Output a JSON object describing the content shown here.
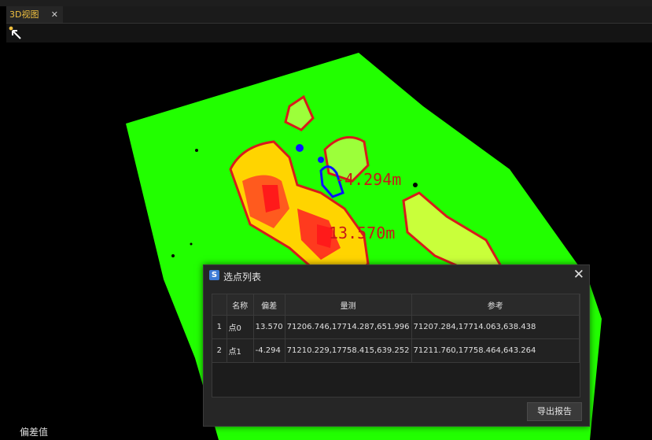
{
  "tab": {
    "label": "3D视图",
    "close_glyph": "✕"
  },
  "toolbar": {
    "select_tool_icon": "cursor-arrow-icon"
  },
  "viewport": {
    "labels": [
      "-4.294m",
      "13.570m"
    ],
    "bottom_label": "偏差值"
  },
  "dialog": {
    "title": "选点列表",
    "icon_glyph": "S",
    "close_glyph": "✕",
    "columns": [
      "",
      "名称",
      "偏差",
      "量测",
      "参考"
    ],
    "rows": [
      [
        "1",
        "点0",
        "13.570",
        "71206.746,17714.287,651.996",
        "71207.284,17714.063,638.438"
      ],
      [
        "2",
        "点1",
        "-4.294",
        "71210.229,17758.415,639.252",
        "71211.760,17758.464,643.264"
      ]
    ],
    "export_label": "导出报告"
  },
  "colors": {
    "terrain_green": "#22ff00",
    "contour_red": "#d81b1b",
    "marker_blue": "#0a14ff",
    "tab_accent": "#f0c040"
  }
}
